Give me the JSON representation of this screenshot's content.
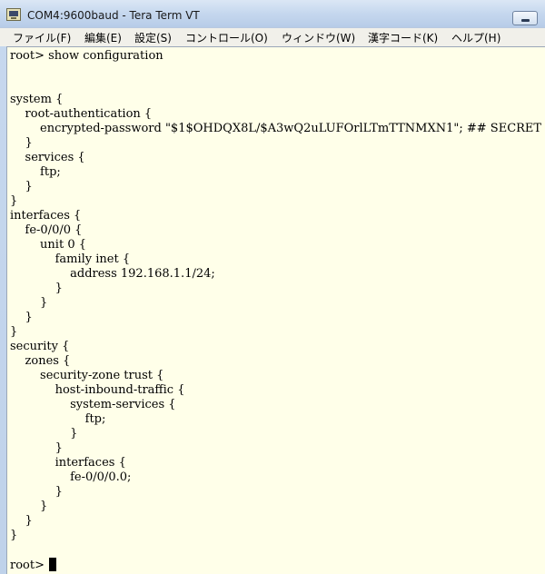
{
  "window": {
    "title": "COM4:9600baud - Tera Term VT"
  },
  "menu": [
    {
      "key": "file",
      "label": "ファイル(F)"
    },
    {
      "key": "edit",
      "label": "編集(E)"
    },
    {
      "key": "setup",
      "label": "設定(S)"
    },
    {
      "key": "control",
      "label": "コントロール(O)"
    },
    {
      "key": "window",
      "label": "ウィンドウ(W)"
    },
    {
      "key": "kanji",
      "label": "漢字コード(K)"
    },
    {
      "key": "help",
      "label": "ヘルプ(H)"
    }
  ],
  "terminal": {
    "lines": [
      "root> show configuration",
      "",
      "",
      "system {",
      "    root-authentication {",
      "        encrypted-password \"$1$OHDQX8L/$A3wQ2uLUFOrlLTmTTNMXN1\"; ## SECRET",
      "    }",
      "    services {",
      "        ftp;",
      "    }",
      "}",
      "interfaces {",
      "    fe-0/0/0 {",
      "        unit 0 {",
      "            family inet {",
      "                address 192.168.1.1/24;",
      "            }",
      "        }",
      "    }",
      "}",
      "security {",
      "    zones {",
      "        security-zone trust {",
      "            host-inbound-traffic {",
      "                system-services {",
      "                    ftp;",
      "                }",
      "            }",
      "            interfaces {",
      "                fe-0/0/0.0;",
      "            }",
      "        }",
      "    }",
      "}",
      "",
      "root> "
    ]
  },
  "colors": {
    "terminal_bg": "#ffffe9",
    "menubar_bg": "#f1f0ea",
    "titlebar": "#c5d7ee"
  },
  "icons": {
    "app": "tera-term-icon",
    "minimize": "minimize-icon"
  }
}
